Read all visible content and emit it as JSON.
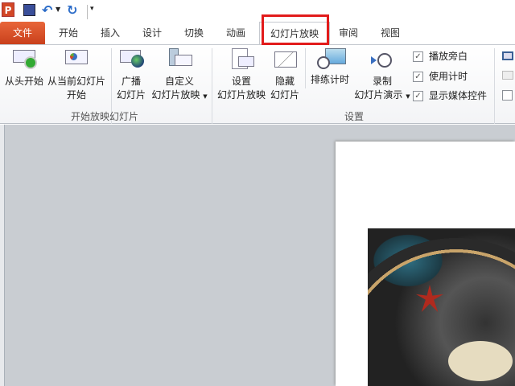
{
  "qat": {
    "app_icon": "P",
    "save": "save-icon",
    "undo": "undo-icon",
    "redo": "redo-icon",
    "customize": "customize-icon"
  },
  "tabs": [
    "文件",
    "开始",
    "插入",
    "设计",
    "切换",
    "动画",
    "幻灯片放映",
    "审阅",
    "视图"
  ],
  "ribbon": {
    "start_group": {
      "label": "开始放映幻灯片",
      "from_beginning": "从头开始",
      "from_current_1": "从当前幻灯片",
      "from_current_2": "开始",
      "broadcast_1": "广播",
      "broadcast_2": "幻灯片",
      "custom_1": "自定义",
      "custom_2": "幻灯片放映"
    },
    "setup_group": {
      "label": "设置",
      "setup_1": "设置",
      "setup_2": "幻灯片放映",
      "hide_1": "隐藏",
      "hide_2": "幻灯片",
      "rehearse": "排练计时",
      "record_1": "录制",
      "record_2": "幻灯片演示"
    },
    "checkboxes": [
      {
        "label": "播放旁白",
        "checked": true
      },
      {
        "label": "使用计时",
        "checked": true
      },
      {
        "label": "显示媒体控件",
        "checked": true
      }
    ]
  },
  "colors": {
    "accent": "#d24726",
    "highlight": "#e21b1b"
  }
}
